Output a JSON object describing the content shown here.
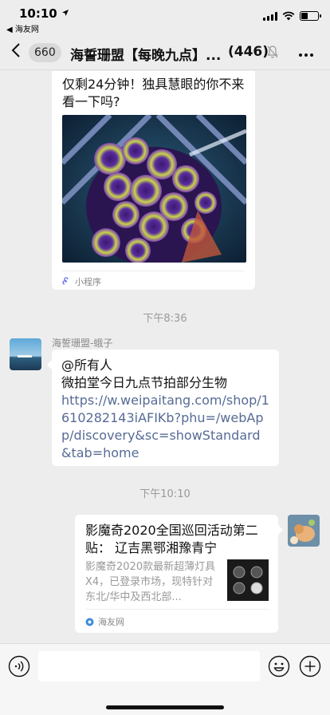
{
  "status_bar": {
    "time": "10:10",
    "back_app_label": "◀ 海友网"
  },
  "nav": {
    "unread_count": "660",
    "title": "海誓珊盟【每晚九点】...",
    "member_count": "(446)"
  },
  "messages": [
    {
      "type": "mini_program",
      "title": "仅剩24分钟！独具慧眼的你不来看一下吗?",
      "footer_label": "小程序"
    },
    {
      "type": "timestamp",
      "text": "下午8:36"
    },
    {
      "type": "text",
      "sender": "海誓珊盟-蛾子",
      "mention": "@所有人",
      "body": "微拍堂今日九点节拍部分生物",
      "link": "https://w.weipaitang.com/shop/1610282143iAFIKb?phu=/webApp/discovery&sc=showStandard&tab=home"
    },
    {
      "type": "timestamp",
      "text": "下午10:10"
    },
    {
      "type": "link_card",
      "title": "影魔奇2020全国巡回活动第二贴： 辽吉黑鄂湘豫青宁",
      "description": "影魔奇2020款最新超薄灯具X4，已登录市场，现特针对东北/华中及西北部...",
      "source": "海友网"
    }
  ],
  "input": {
    "placeholder": ""
  },
  "colors": {
    "background": "#ededed",
    "link": "#576b95",
    "bubble": "#ffffff",
    "muted_text": "#999999"
  }
}
